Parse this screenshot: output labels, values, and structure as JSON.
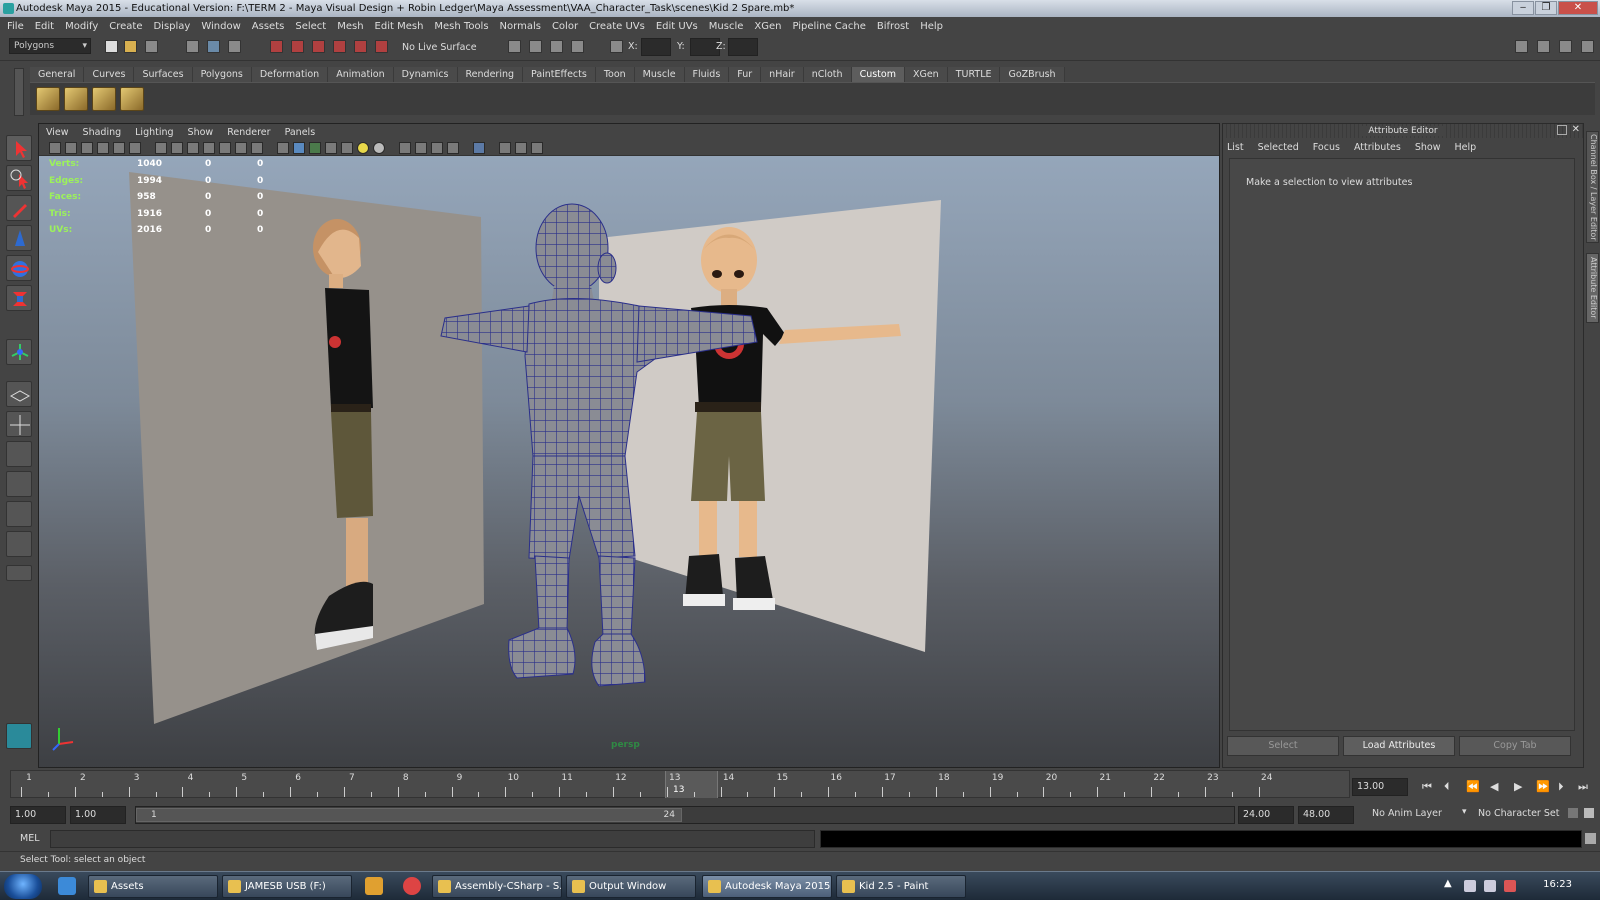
{
  "window": {
    "title": "Autodesk Maya 2015 - Educational Version: F:\\TERM 2 - Maya Visual Design + Robin Ledger\\Maya Assessment\\VAA_Character_Task\\scenes\\Kid 2 Spare.mb*",
    "buttons": [
      "‒",
      "❐",
      "✕"
    ]
  },
  "menubar": [
    "File",
    "Edit",
    "Modify",
    "Create",
    "Display",
    "Window",
    "Assets",
    "Select",
    "Mesh",
    "Edit Mesh",
    "Mesh Tools",
    "Normals",
    "Color",
    "Create UVs",
    "Edit UVs",
    "Muscle",
    "XGen",
    "Pipeline Cache",
    "Bifrost",
    "Help"
  ],
  "statusline": {
    "mode": "Polygons",
    "live_surface": "No Live Surface",
    "x_label": "X:",
    "y_label": "Y:",
    "z_label": "Z:"
  },
  "shelf_tabs": [
    "General",
    "Curves",
    "Surfaces",
    "Polygons",
    "Deformation",
    "Animation",
    "Dynamics",
    "Rendering",
    "PaintEffects",
    "Toon",
    "Muscle",
    "Fluids",
    "Fur",
    "nHair",
    "nCloth",
    "Custom",
    "XGen",
    "TURTLE",
    "GoZBrush"
  ],
  "shelf_active": "Custom",
  "viewport": {
    "menu": [
      "View",
      "Shading",
      "Lighting",
      "Show",
      "Renderer",
      "Panels"
    ],
    "hud": [
      {
        "label": "Verts:",
        "v1": "1040",
        "v2": "0",
        "v3": "0"
      },
      {
        "label": "Edges:",
        "v1": "1994",
        "v2": "0",
        "v3": "0"
      },
      {
        "label": "Faces:",
        "v1": "958",
        "v2": "0",
        "v3": "0"
      },
      {
        "label": "Tris:",
        "v1": "1916",
        "v2": "0",
        "v3": "0"
      },
      {
        "label": "UVs:",
        "v1": "2016",
        "v2": "0",
        "v3": "0"
      }
    ],
    "camera": "persp"
  },
  "attribute_editor": {
    "title": "Attribute Editor",
    "menu": [
      "List",
      "Selected",
      "Focus",
      "Attributes",
      "Show",
      "Help"
    ],
    "message": "Make a selection to view attributes",
    "buttons": {
      "select": "Select",
      "load": "Load Attributes",
      "copy": "Copy Tab"
    },
    "side_tabs": [
      "Channel Box / Layer Editor",
      "Attribute Editor"
    ]
  },
  "timeline": {
    "ticks": [
      "1",
      "2",
      "3",
      "4",
      "5",
      "6",
      "7",
      "8",
      "9",
      "10",
      "11",
      "12",
      "13",
      "14",
      "15",
      "16",
      "17",
      "18",
      "19",
      "20",
      "21",
      "22",
      "23",
      "24"
    ],
    "current": "13",
    "current_field": "13.00"
  },
  "range": {
    "start_a": "1.00",
    "start_b": "1.00",
    "bar_start": "1",
    "bar_end": "24",
    "end_a": "24.00",
    "end_b": "48.00",
    "anim_layer": "No Anim Layer",
    "char_set": "No Character Set"
  },
  "command": {
    "label": "MEL"
  },
  "status": "Select Tool: select an object",
  "taskbar": {
    "tasks": [
      "Assets",
      "JAMESB USB (F:)",
      "Assembly-CSharp - S...",
      "Output Window",
      "Autodesk Maya 2015...",
      "Kid 2.5 - Paint"
    ],
    "active": "Autodesk Maya 2015...",
    "clock": "16:23"
  },
  "colors": {
    "hud_label": "#9cf25a",
    "wire": "#2a2f8a",
    "shirt": "#111111",
    "shorts": "#6b6444",
    "skin": "#e7b98c"
  }
}
